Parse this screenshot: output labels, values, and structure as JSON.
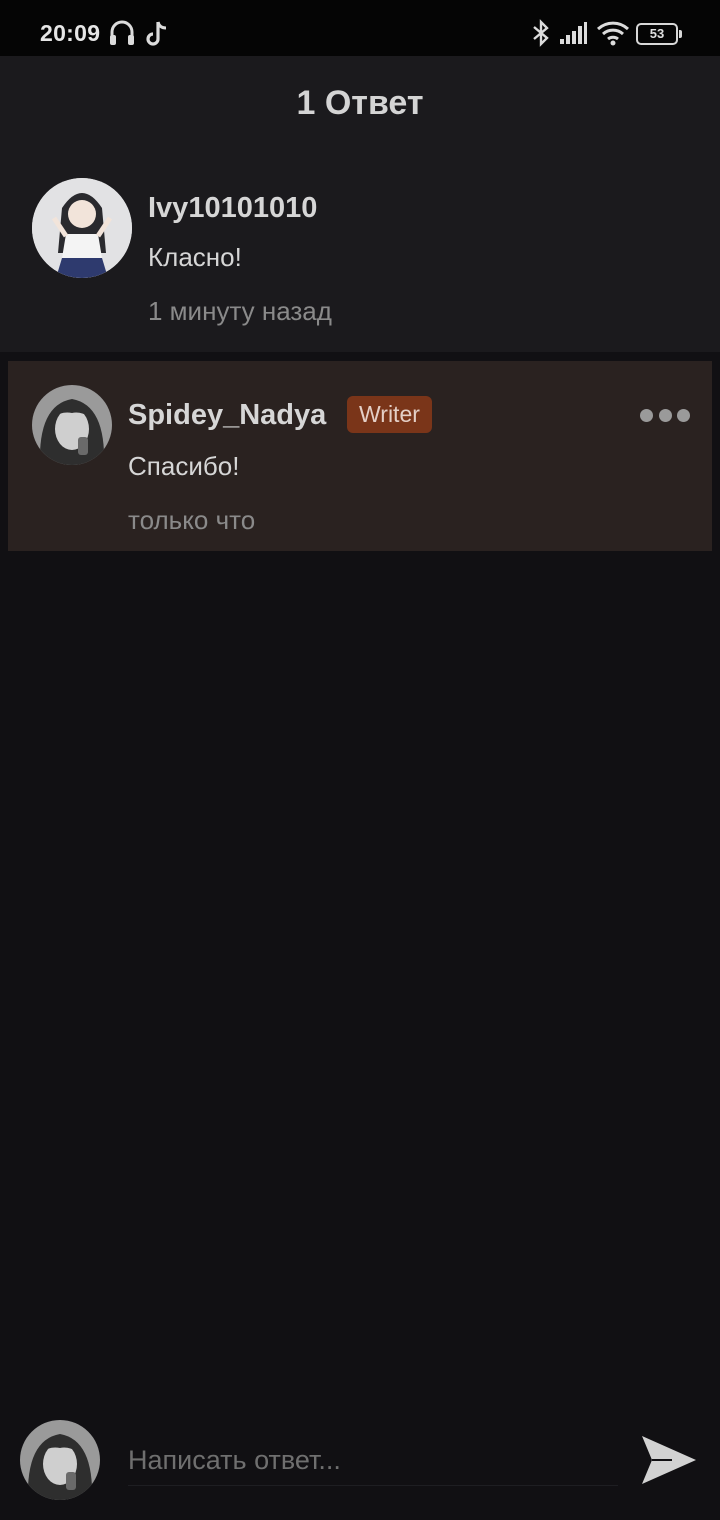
{
  "status_bar": {
    "time": "20:09",
    "battery": "53",
    "icons": [
      "headphones-icon",
      "tiktok-icon",
      "bluetooth-icon",
      "signal-icon",
      "wifi-icon",
      "battery-icon"
    ]
  },
  "header": {
    "title": "1 Ответ"
  },
  "parent_comment": {
    "username": "Ivy10101010",
    "text": "Класно!",
    "time": "1 минуту назад"
  },
  "reply": {
    "username": "Spidey_Nadya",
    "badge": "Writer",
    "text": "Спасибо!",
    "time": "только что",
    "highlight_color": "#2a2220",
    "badge_color": "#7a3519"
  },
  "composer": {
    "placeholder": "Написать ответ...",
    "send_icon": "send-icon"
  }
}
